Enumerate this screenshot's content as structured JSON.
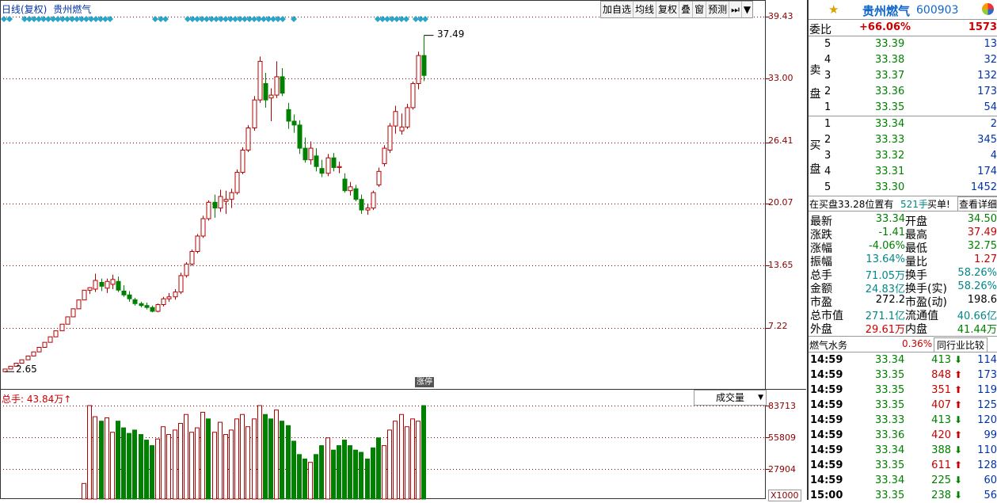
{
  "header": {
    "title": "日线(复权)",
    "stock_name": "贵州燃气"
  },
  "toolbar": [
    "加自选",
    "均线",
    "复权",
    "叠",
    "窗",
    "预测",
    "⏭",
    "▼"
  ],
  "price_axis": [
    "39.43",
    "33.00",
    "26.41",
    "20.07",
    "13.65",
    "7.22"
  ],
  "marks": {
    "high": "37.49",
    "low": "2.65",
    "tag": "涨停"
  },
  "volume": {
    "title": "总手: 43.84万",
    "indicator": "成交量",
    "axis": [
      "83713",
      "55809",
      "27904"
    ],
    "unit": "X1000"
  },
  "colors": {
    "up": "#b30000",
    "down": "#008000",
    "diamond": "#2aa5c8",
    "grid": "#8b0000"
  },
  "chart_data": {
    "type": "candlestick",
    "ylim": [
      0,
      39.43
    ],
    "candles": [
      [
        2.65,
        2.92,
        2.65,
        2.92
      ],
      [
        2.92,
        3.21,
        2.92,
        3.21
      ],
      [
        3.21,
        3.53,
        3.21,
        3.53
      ],
      [
        3.53,
        3.88,
        3.53,
        3.88
      ],
      [
        3.88,
        4.27,
        3.88,
        4.27
      ],
      [
        4.27,
        4.7,
        4.27,
        4.7
      ],
      [
        4.7,
        5.17,
        4.7,
        5.17
      ],
      [
        5.17,
        5.69,
        5.17,
        5.69
      ],
      [
        5.69,
        6.26,
        5.69,
        6.26
      ],
      [
        6.26,
        6.88,
        6.26,
        6.88
      ],
      [
        6.88,
        7.57,
        6.88,
        7.57
      ],
      [
        7.57,
        8.33,
        7.57,
        8.33
      ],
      [
        8.33,
        9.16,
        8.33,
        9.16
      ],
      [
        9.16,
        10.08,
        9.16,
        10.08
      ],
      [
        10.08,
        11.09,
        10.08,
        11.09
      ],
      [
        11.09,
        11.4,
        10.7,
        11.35
      ],
      [
        11.2,
        12.8,
        10.9,
        12.1
      ],
      [
        11.9,
        12.3,
        11.0,
        11.5
      ],
      [
        11.3,
        12.3,
        10.8,
        12.0
      ],
      [
        11.7,
        12.7,
        11.2,
        12.2
      ],
      [
        12.0,
        12.5,
        10.9,
        11.1
      ],
      [
        11.0,
        11.6,
        10.4,
        10.6
      ],
      [
        10.6,
        11.0,
        9.9,
        10.2
      ],
      [
        10.1,
        10.3,
        9.5,
        9.7
      ],
      [
        9.7,
        9.9,
        9.3,
        9.5
      ],
      [
        9.5,
        9.8,
        9.1,
        9.3
      ],
      [
        9.3,
        9.5,
        8.8,
        8.9
      ],
      [
        8.9,
        9.7,
        8.8,
        9.6
      ],
      [
        9.6,
        10.4,
        9.4,
        10.2
      ],
      [
        10.2,
        10.8,
        9.9,
        10.4
      ],
      [
        10.4,
        11.2,
        10.1,
        10.9
      ],
      [
        10.9,
        12.9,
        10.7,
        12.6
      ],
      [
        12.6,
        14.0,
        12.4,
        13.8
      ],
      [
        13.8,
        15.3,
        13.6,
        15.1
      ],
      [
        15.1,
        16.9,
        14.9,
        16.7
      ],
      [
        16.7,
        18.8,
        16.5,
        18.5
      ],
      [
        18.5,
        20.4,
        18.3,
        20.2
      ],
      [
        20.2,
        21.0,
        18.6,
        19.6
      ],
      [
        19.6,
        21.5,
        19.2,
        20.8
      ],
      [
        20.3,
        21.4,
        19.0,
        20.5
      ],
      [
        20.5,
        21.6,
        19.6,
        21.2
      ],
      [
        21.2,
        23.6,
        21.0,
        23.3
      ],
      [
        23.3,
        25.9,
        23.1,
        25.6
      ],
      [
        25.6,
        28.2,
        25.4,
        27.9
      ],
      [
        27.9,
        31.2,
        27.6,
        30.8
      ],
      [
        30.8,
        35.3,
        30.5,
        34.8
      ],
      [
        32.5,
        33.6,
        30.0,
        30.8
      ],
      [
        31.0,
        32.0,
        28.6,
        31.3
      ],
      [
        31.3,
        34.8,
        31.0,
        33.2
      ],
      [
        33.2,
        34.1,
        31.2,
        31.5
      ],
      [
        29.8,
        30.5,
        27.8,
        28.6
      ],
      [
        28.6,
        29.3,
        27.4,
        28.2
      ],
      [
        28.2,
        28.7,
        25.2,
        25.8
      ],
      [
        25.8,
        26.9,
        24.3,
        24.6
      ],
      [
        24.6,
        26.5,
        24.1,
        25.8
      ],
      [
        25.0,
        25.8,
        23.4,
        23.9
      ],
      [
        23.7,
        24.6,
        22.8,
        23.2
      ],
      [
        23.2,
        25.2,
        22.9,
        24.8
      ],
      [
        24.8,
        25.3,
        23.4,
        23.8
      ],
      [
        23.8,
        24.4,
        23.2,
        23.9
      ],
      [
        22.6,
        23.2,
        21.2,
        21.4
      ],
      [
        21.4,
        22.3,
        20.9,
        21.8
      ],
      [
        21.6,
        22.0,
        20.3,
        20.5
      ],
      [
        20.5,
        21.0,
        19.0,
        19.4
      ],
      [
        19.4,
        20.0,
        18.9,
        19.6
      ],
      [
        19.6,
        21.4,
        19.4,
        21.2
      ],
      [
        22.0,
        23.8,
        21.8,
        23.4
      ],
      [
        24.2,
        26.1,
        23.9,
        25.8
      ],
      [
        25.6,
        28.4,
        25.3,
        28.1
      ],
      [
        28.1,
        30.2,
        27.3,
        29.6
      ],
      [
        27.6,
        29.4,
        27.2,
        28.0
      ],
      [
        28.0,
        30.4,
        27.8,
        30.0
      ],
      [
        30.0,
        32.7,
        29.8,
        32.5
      ],
      [
        32.5,
        35.8,
        31.9,
        35.4
      ],
      [
        35.4,
        37.49,
        32.75,
        33.34
      ]
    ],
    "volumes": [
      null,
      null,
      null,
      null,
      null,
      null,
      null,
      null,
      null,
      null,
      null,
      null,
      null,
      null,
      [
        14,
        "up"
      ],
      [
        84,
        "up"
      ],
      [
        74,
        "up"
      ],
      [
        70,
        "down"
      ],
      [
        73,
        "up"
      ],
      [
        60,
        "up"
      ],
      [
        70,
        "down"
      ],
      [
        64,
        "down"
      ],
      [
        59,
        "down"
      ],
      [
        62,
        "down"
      ],
      [
        58,
        "down"
      ],
      [
        53,
        "down"
      ],
      [
        48,
        "down"
      ],
      [
        54,
        "up"
      ],
      [
        65,
        "up"
      ],
      [
        58,
        "up"
      ],
      [
        62,
        "up"
      ],
      [
        68,
        "up"
      ],
      [
        76,
        "up"
      ],
      [
        60,
        "up"
      ],
      [
        64,
        "up"
      ],
      [
        78,
        "up"
      ],
      [
        72,
        "down"
      ],
      [
        60,
        "up"
      ],
      [
        69,
        "up"
      ],
      [
        58,
        "up"
      ],
      [
        62,
        "up"
      ],
      [
        72,
        "up"
      ],
      [
        76,
        "up"
      ],
      [
        65,
        "up"
      ],
      [
        72,
        "up"
      ],
      [
        84,
        "up"
      ],
      [
        76,
        "down"
      ],
      [
        72,
        "down"
      ],
      [
        80,
        "up"
      ],
      [
        70,
        "down"
      ],
      [
        66,
        "down"
      ],
      [
        52,
        "down"
      ],
      [
        40,
        "down"
      ],
      [
        36,
        "down"
      ],
      [
        33,
        "up"
      ],
      [
        40,
        "down"
      ],
      [
        48,
        "down"
      ],
      [
        55,
        "up"
      ],
      [
        44,
        "down"
      ],
      [
        48,
        "down"
      ],
      [
        53,
        "down"
      ],
      [
        48,
        "down"
      ],
      [
        44,
        "down"
      ],
      [
        42,
        "down"
      ],
      [
        36,
        "down"
      ],
      [
        46,
        "down"
      ],
      [
        55,
        "down"
      ],
      [
        48,
        "up"
      ],
      [
        62,
        "up"
      ],
      [
        70,
        "up"
      ],
      [
        76,
        "up"
      ],
      [
        65,
        "up"
      ],
      [
        72,
        "up"
      ],
      [
        70,
        "up"
      ],
      [
        84,
        "down"
      ]
    ]
  },
  "panel": {
    "name": "贵州燃气",
    "code": "600903",
    "wei_bi_label": "委比",
    "wei_bi": "+66.06%",
    "wei_cha": "1573",
    "sell_label": "卖盘",
    "buy_label": "买盘",
    "sell": [
      [
        "5",
        "33.39",
        "13"
      ],
      [
        "4",
        "33.38",
        "32"
      ],
      [
        "3",
        "33.37",
        "132"
      ],
      [
        "2",
        "33.36",
        "173"
      ],
      [
        "1",
        "33.35",
        "54"
      ]
    ],
    "buy": [
      [
        "1",
        "33.34",
        "2"
      ],
      [
        "2",
        "33.33",
        "345"
      ],
      [
        "3",
        "33.32",
        "4"
      ],
      [
        "4",
        "33.31",
        "174"
      ],
      [
        "5",
        "33.30",
        "1452"
      ]
    ],
    "queue": {
      "text": "在买盘33.28位置有",
      "qty": "521手",
      "buy": "买单!",
      "detail": "查看详细"
    },
    "stats": [
      [
        "最新",
        "33.34",
        "开盘",
        "34.50"
      ],
      [
        "涨跌",
        "-1.41",
        "最高",
        "37.49"
      ],
      [
        "涨幅",
        "-4.06%",
        "最低",
        "32.75"
      ],
      [
        "振幅",
        "13.64%",
        "量比",
        "1.27"
      ],
      [
        "总手",
        "71.05万",
        "换手",
        "58.26%"
      ],
      [
        "金额",
        "24.83亿",
        "换手(实)",
        "58.26%"
      ],
      [
        "市盈",
        "272.2",
        "市盈(动)",
        "198.6"
      ],
      [
        "总市值",
        "271.1亿",
        "流通值",
        "40.66亿"
      ],
      [
        "外盘",
        "29.61万",
        "内盘",
        "41.44万"
      ]
    ],
    "sector": {
      "name": "燃气水务",
      "change": "0.36%",
      "compare": "同行业比较"
    },
    "trades": [
      [
        "14:59",
        "33.34",
        "413",
        "down",
        "114"
      ],
      [
        "14:59",
        "33.35",
        "848",
        "up",
        "173"
      ],
      [
        "14:59",
        "33.35",
        "351",
        "up",
        "119"
      ],
      [
        "14:59",
        "33.35",
        "407",
        "up",
        "125"
      ],
      [
        "14:59",
        "33.33",
        "413",
        "down",
        "120"
      ],
      [
        "14:59",
        "33.36",
        "420",
        "up",
        "99"
      ],
      [
        "14:59",
        "33.34",
        "388",
        "down",
        "110"
      ],
      [
        "14:59",
        "33.35",
        "611",
        "up",
        "128"
      ],
      [
        "14:59",
        "33.34",
        "225",
        "down",
        "60"
      ],
      [
        "15:00",
        "33.35",
        "238",
        "down",
        "56"
      ]
    ]
  }
}
